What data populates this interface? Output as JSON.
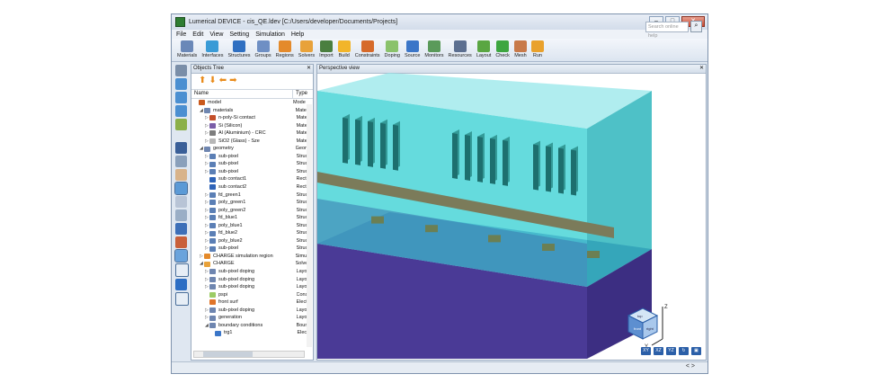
{
  "window": {
    "title": "Lumerical DEVICE - cis_QE.ldev [C:/Users/developer/Documents/Projects]",
    "buttons": [
      "–",
      "□",
      "✕"
    ]
  },
  "menu": [
    "File",
    "Edit",
    "View",
    "Setting",
    "Simulation",
    "Help"
  ],
  "toolbar": [
    {
      "label": "Materials",
      "color": "#6a88b8"
    },
    {
      "label": "Interfaces",
      "color": "#3a9bd6"
    },
    {
      "label": "Structures",
      "color": "#2f6fc1"
    },
    {
      "label": "Groups",
      "color": "#6e8fc4"
    },
    {
      "label": "Regions",
      "color": "#e48a2b"
    },
    {
      "label": "Solvers",
      "color": "#e8a23a"
    },
    {
      "label": "Import",
      "color": "#4a7f3f"
    },
    {
      "label": "Build",
      "color": "#f2b52a"
    },
    {
      "label": "Constraints",
      "color": "#d66a2a"
    },
    {
      "label": "Doping",
      "color": "#8ac26b"
    },
    {
      "label": "Source",
      "color": "#3b76c8"
    },
    {
      "label": "Monitors",
      "color": "#5a9a5a"
    },
    {
      "label": "Resources",
      "color": "#5c6f90"
    },
    {
      "label": "Layout",
      "color": "#5aa642"
    },
    {
      "label": "Check",
      "color": "#3da640"
    },
    {
      "label": "Mesh",
      "color": "#c87a4a"
    },
    {
      "label": "Run",
      "color": "#e9a12c"
    }
  ],
  "search": {
    "placeholder": "Search online help"
  },
  "objects_tree": {
    "title": "Objects Tree",
    "col_name": "Name",
    "col_type": "Type",
    "rows": [
      {
        "indent": 0,
        "toggle": "",
        "name": "model",
        "type": "Mode",
        "icon": "#c9591d"
      },
      {
        "indent": 1,
        "toggle": "◢",
        "name": "materials",
        "type": "Mate",
        "icon": "#6f86b0"
      },
      {
        "indent": 2,
        "toggle": "▷",
        "name": "n-poly-Si contact",
        "type": "Mate",
        "icon": "#c44f2a"
      },
      {
        "indent": 2,
        "toggle": "▷",
        "name": "Si (Silicon)",
        "type": "Mate",
        "icon": "#7b5ea8"
      },
      {
        "indent": 2,
        "toggle": "▷",
        "name": "Al (Aluminium) - CRC",
        "type": "Mate",
        "icon": "#7d7d7d"
      },
      {
        "indent": 2,
        "toggle": "▷",
        "name": "SiO2 (Glass) - Sze",
        "type": "Mate",
        "icon": "#b7b7b7"
      },
      {
        "indent": 1,
        "toggle": "◢",
        "name": "geometry",
        "type": "Geom",
        "icon": "#6f86b0"
      },
      {
        "indent": 2,
        "toggle": "▷",
        "name": "sub-pixel",
        "type": "Struc",
        "icon": "#5b7fb5"
      },
      {
        "indent": 2,
        "toggle": "▷",
        "name": "sub-pixel",
        "type": "Struc",
        "icon": "#5b7fb5"
      },
      {
        "indent": 2,
        "toggle": "▷",
        "name": "sub-pixel",
        "type": "Struc",
        "icon": "#5b7fb5"
      },
      {
        "indent": 2,
        "toggle": "",
        "name": "sub contact1",
        "type": "Recta",
        "icon": "#2e63b8"
      },
      {
        "indent": 2,
        "toggle": "",
        "name": "sub contact2",
        "type": "Recta",
        "icon": "#2e63b8"
      },
      {
        "indent": 2,
        "toggle": "▷",
        "name": "fd_green1",
        "type": "Struc",
        "icon": "#5b7fb5"
      },
      {
        "indent": 2,
        "toggle": "▷",
        "name": "poly_green1",
        "type": "Struc",
        "icon": "#5b7fb5"
      },
      {
        "indent": 2,
        "toggle": "▷",
        "name": "poly_green2",
        "type": "Struc",
        "icon": "#5b7fb5"
      },
      {
        "indent": 2,
        "toggle": "▷",
        "name": "fd_blue1",
        "type": "Struc",
        "icon": "#5b7fb5"
      },
      {
        "indent": 2,
        "toggle": "▷",
        "name": "poly_blue1",
        "type": "Struc",
        "icon": "#5b7fb5"
      },
      {
        "indent": 2,
        "toggle": "▷",
        "name": "fd_blue2",
        "type": "Struc",
        "icon": "#5b7fb5"
      },
      {
        "indent": 2,
        "toggle": "▷",
        "name": "poly_blue2",
        "type": "Struc",
        "icon": "#5b7fb5"
      },
      {
        "indent": 2,
        "toggle": "▷",
        "name": "sub-pixel",
        "type": "Struc",
        "icon": "#5b7fb5"
      },
      {
        "indent": 1,
        "toggle": "▷",
        "name": "CHARGE simulation region",
        "type": "Simu",
        "icon": "#e48a2b"
      },
      {
        "indent": 1,
        "toggle": "◢",
        "name": "CHARGE",
        "type": "Solve",
        "icon": "#e8a23a"
      },
      {
        "indent": 2,
        "toggle": "▷",
        "name": "sub-pixel doping",
        "type": "Layo",
        "icon": "#6f86b0"
      },
      {
        "indent": 2,
        "toggle": "▷",
        "name": "sub-pixel doping",
        "type": "Layo",
        "icon": "#6f86b0"
      },
      {
        "indent": 2,
        "toggle": "▷",
        "name": "sub-pixel doping",
        "type": "Layo",
        "icon": "#6f86b0"
      },
      {
        "indent": 2,
        "toggle": "",
        "name": "pspi",
        "type": "Cons",
        "icon": "#9ccc65"
      },
      {
        "indent": 2,
        "toggle": "",
        "name": "front surf",
        "type": "Electi",
        "icon": "#e0752a"
      },
      {
        "indent": 2,
        "toggle": "▷",
        "name": "sub-pixel doping",
        "type": "Layo",
        "icon": "#6f86b0"
      },
      {
        "indent": 2,
        "toggle": "▷",
        "name": "generation",
        "type": "Layo",
        "icon": "#6f86b0"
      },
      {
        "indent": 2,
        "toggle": "◢",
        "name": "boundary conditions",
        "type": "Boun",
        "icon": "#6f86b0"
      },
      {
        "indent": 3,
        "toggle": "",
        "name": "trg1",
        "type": "Electi",
        "icon": "#3b76c8"
      }
    ]
  },
  "view": {
    "title": "Perspective view",
    "axes": {
      "z": "Z",
      "y": "Y",
      "x": "X"
    },
    "cube": {
      "top": "top",
      "front": "front",
      "right": "right"
    },
    "buttons": [
      "XY",
      "XZ",
      "YZ",
      "↻",
      "▣"
    ]
  },
  "status": {
    "pager": "< >"
  },
  "colors": {
    "cyan": "#43d3d6",
    "purple": "#4b3a95",
    "gate": "#7b7b5a",
    "blue": "#3c7fb3"
  }
}
